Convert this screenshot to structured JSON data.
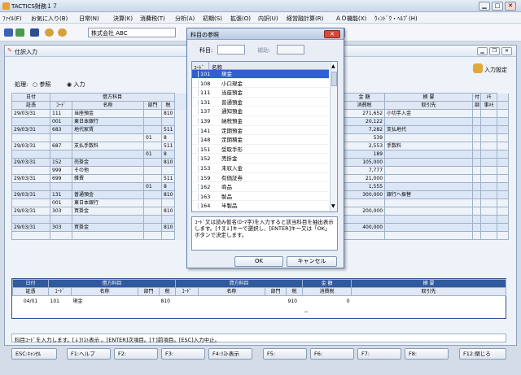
{
  "app": {
    "title": "TACTICS財務１７"
  },
  "menu": [
    "ﾌｧｲﾙ(F)",
    "お気に入り(B)",
    "日常(N)",
    "決算(K)",
    "消費税(T)",
    "分析(A)",
    "初期(S)",
    "拡張(O)",
    "内訳(U)",
    "経営融計算(R)",
    "ＡＯ機能(X)",
    "ｳｨﾝﾄﾞｳ・ﾍﾙﾌﾟ(H)"
  ],
  "toolbar": {
    "company": "株式会社 ABC"
  },
  "child": {
    "title": "仕訳入力",
    "settings": "入力設定",
    "mode_label": "処理:",
    "mode_ref": "参照",
    "mode_input": "入力"
  },
  "grid": {
    "h1": [
      "日付",
      "借方科目",
      "金 額",
      "摘 要",
      "付",
      "ﾒﾓ"
    ],
    "h2": [
      "証憑",
      "ｺｰﾄﾞ",
      "名称",
      "部門",
      "税",
      "消費税",
      "取引先",
      "調",
      "事ﾒﾓ"
    ],
    "rows": [
      {
        "date": "29/03/31",
        "code": "111",
        "name": "当座預金",
        "dept": "",
        "tax": "810",
        "amt": "271,652",
        "memo": "小切手入金"
      },
      {
        "date": "",
        "code": "001",
        "name": "東日本銀行",
        "dept": "",
        "tax": "",
        "amt": "20,122",
        "memo": ""
      },
      {
        "date": "29/03/31",
        "code": "683",
        "name": "地代家賃",
        "dept": "",
        "tax": "511",
        "amt": "7,282",
        "memo": "支払地代"
      },
      {
        "date": "",
        "code": "",
        "name": "",
        "dept": "01",
        "tax": "8",
        "amt": "539",
        "memo": ""
      },
      {
        "date": "29/03/31",
        "code": "687",
        "name": "支払手数料",
        "dept": "",
        "tax": "511",
        "amt": "2,553",
        "memo": "手数料"
      },
      {
        "date": "",
        "code": "",
        "name": "",
        "dept": "01",
        "tax": "8",
        "amt": "189",
        "memo": ""
      },
      {
        "date": "29/03/31",
        "code": "152",
        "name": "売掛金",
        "dept": "",
        "tax": "810",
        "amt": "105,000",
        "memo": ""
      },
      {
        "date": "",
        "code": "999",
        "name": "その他",
        "dept": "",
        "tax": "",
        "amt": "7,777",
        "memo": ""
      },
      {
        "date": "29/03/31",
        "code": "699",
        "name": "雑費",
        "dept": "",
        "tax": "511",
        "amt": "21,000",
        "memo": ""
      },
      {
        "date": "",
        "code": "",
        "name": "",
        "dept": "01",
        "tax": "8",
        "amt": "1,555",
        "memo": ""
      },
      {
        "date": "29/03/31",
        "code": "131",
        "name": "普通預金",
        "dept": "",
        "tax": "810",
        "amt": "300,000",
        "memo": "銀行へ振替"
      },
      {
        "date": "",
        "code": "001",
        "name": "東日本銀行",
        "dept": "",
        "tax": "",
        "amt": "",
        "memo": ""
      },
      {
        "date": "29/03/31",
        "code": "303",
        "name": "買掛金",
        "dept": "",
        "tax": "810",
        "amt": "200,000",
        "memo": ""
      },
      {
        "date": "",
        "code": "",
        "name": "",
        "dept": "",
        "tax": "",
        "amt": "",
        "memo": ""
      },
      {
        "date": "29/03/31",
        "code": "303",
        "name": "買掛金",
        "dept": "",
        "tax": "810",
        "amt": "400,000",
        "memo": ""
      },
      {
        "date": "",
        "code": "",
        "name": "",
        "dept": "",
        "tax": "",
        "amt": "",
        "memo": ""
      }
    ]
  },
  "entry": {
    "h1": [
      "日付",
      "借方科目",
      "貸方科目",
      "金 額",
      "摘 要"
    ],
    "h2": [
      "証憑",
      "ｺｰﾄﾞ",
      "名称",
      "部門",
      "税",
      "ｺｰﾄﾞ",
      "名称",
      "部門",
      "税",
      "消費税",
      "取引先"
    ],
    "date": "04/01",
    "code": "101",
    "name": "現金",
    "tax": "810",
    "ctax": "910",
    "amount": "0",
    "dash": "−"
  },
  "status": "科目ｺｰﾄﾞを入力します。[↓]ﾘｽﾄ表示 。[ENTER]次項目。[↑]前項目。[ESC]入力中止。",
  "fkeys": [
    "ESC:ｷｬﾝｾﾙ",
    "F1:ヘルプ",
    "F2:",
    "F3:",
    "F4:ﾘｽﾄ表示",
    "F5:",
    "F6:",
    "F7:",
    "F8:",
    "F12:閉じる"
  ],
  "dialog": {
    "title": "科目の参照",
    "subject_label": "科目:",
    "aux_label": "補助:",
    "col_code": "ｺｰﾄﾞ",
    "col_name": "名称",
    "items": [
      {
        "code": "101",
        "name": "現金"
      },
      {
        "code": "108",
        "name": "小口現金"
      },
      {
        "code": "111",
        "name": "当座預金"
      },
      {
        "code": "131",
        "name": "普通預金"
      },
      {
        "code": "137",
        "name": "通知預金"
      },
      {
        "code": "139",
        "name": "納税預金"
      },
      {
        "code": "141",
        "name": "定期預金"
      },
      {
        "code": "148",
        "name": "定期積金"
      },
      {
        "code": "151",
        "name": "受取手形"
      },
      {
        "code": "152",
        "name": "売掛金"
      },
      {
        "code": "153",
        "name": "未収入金"
      },
      {
        "code": "159",
        "name": "有価証券"
      },
      {
        "code": "162",
        "name": "商品"
      },
      {
        "code": "163",
        "name": "製品"
      },
      {
        "code": "164",
        "name": "半製品"
      }
    ],
    "hint": "ｺｰﾄﾞ又は読み仮名(ﾛｰﾏ字)を入力すると該当科目を抽出表示します。[↑][↓]キーで選択し、[ENTER]キー又は「OK」ボタンで決定します。",
    "ok": "OK",
    "cancel": "キャンセル"
  }
}
